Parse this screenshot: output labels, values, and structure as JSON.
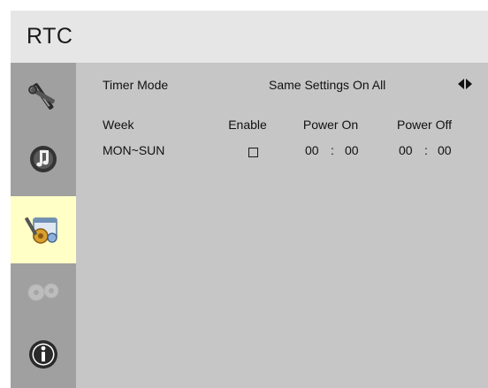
{
  "header": {
    "title": "RTC"
  },
  "sidebar": {
    "items": [
      {
        "icon": "wrench-screwdriver-icon",
        "active": false
      },
      {
        "icon": "audio-speaker-icon",
        "active": false
      },
      {
        "icon": "settings-tools-icon",
        "active": true
      },
      {
        "icon": "gears-icon",
        "active": false
      },
      {
        "icon": "info-icon",
        "active": false
      }
    ]
  },
  "timer": {
    "label": "Timer Mode",
    "value": "Same Settings On All"
  },
  "table": {
    "headers": {
      "week": "Week",
      "enable": "Enable",
      "power_on": "Power On",
      "power_off": "Power Off"
    },
    "rows": [
      {
        "week": "MON~SUN",
        "enable_symbol": "☐",
        "power_on": {
          "hour": "00",
          "sep": ":",
          "minute": "00"
        },
        "power_off": {
          "hour": "00",
          "sep": ":",
          "minute": "00"
        }
      }
    ]
  },
  "colors": {
    "header_bg": "#e6e6e6",
    "sidebar_bg": "#a0a0a0",
    "content_bg": "#c6c6c6",
    "active_item_bg": "#ffffc6"
  }
}
